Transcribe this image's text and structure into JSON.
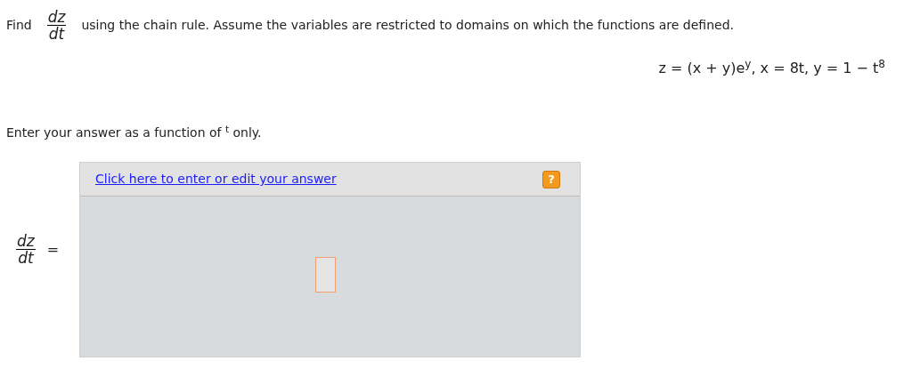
{
  "question": {
    "lead": "Find",
    "fraction": {
      "numerator": "dz",
      "denominator": "dt"
    },
    "text": "using the chain rule. Assume the variables are restricted to domains on which the functions are defined."
  },
  "equation": "z = (x + y)e$^{y}$, x = 8t, y = 1 − t$^{8}$",
  "instruction": "Enter your answer as a function of $^{t}$ only.",
  "answer": {
    "fraction": {
      "numerator": "dz",
      "denominator": "dt"
    },
    "equals": "=",
    "link": "Click here to enter or edit your answer",
    "help_label": "?"
  }
}
